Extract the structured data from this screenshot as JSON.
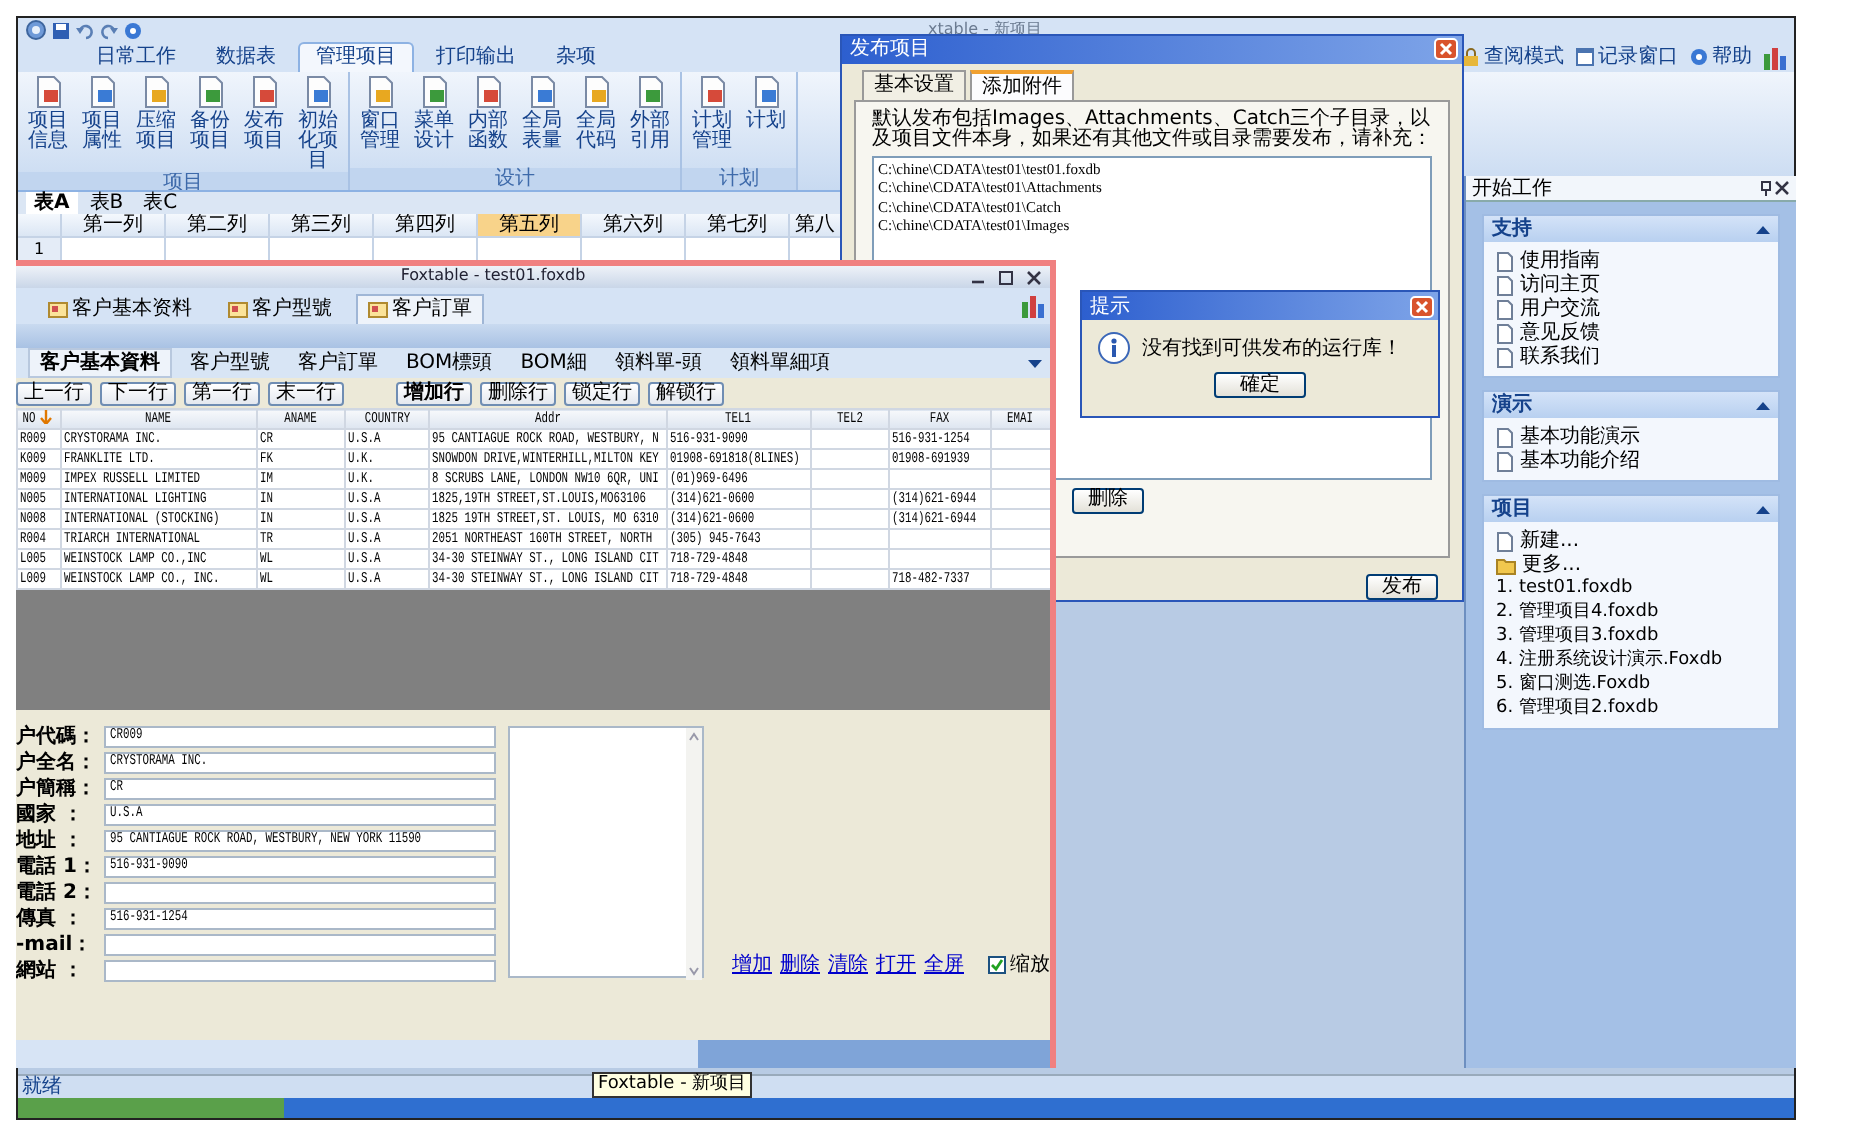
{
  "app_title": "xtable - 新项目",
  "ribbon": {
    "tabs": [
      {
        "label": "日常工作",
        "selected": false
      },
      {
        "label": "数据表",
        "selected": false
      },
      {
        "label": "管理项目",
        "selected": true
      },
      {
        "label": "打印输出",
        "selected": false
      },
      {
        "label": "杂项",
        "selected": false
      }
    ],
    "links": [
      "查阅模式",
      "记录窗口",
      "帮助"
    ],
    "groups": [
      {
        "label": "项目",
        "buttons": [
          "项目信息",
          "项目属性",
          "压缩项目",
          "备份项目",
          "发布项目",
          "初始化项目"
        ]
      },
      {
        "label": "设计",
        "buttons": [
          "窗口管理",
          "菜单设计",
          "内部函数",
          "全局表量",
          "全局代码",
          "外部引用"
        ]
      },
      {
        "label": "计划",
        "buttons": [
          "计划管理",
          "计划"
        ]
      }
    ]
  },
  "sheet_tabs": [
    {
      "label": "表A",
      "selected": true
    },
    {
      "label": "表B",
      "selected": false
    },
    {
      "label": "表C",
      "selected": false
    }
  ],
  "grid": {
    "columns": [
      {
        "label": "第一列",
        "selected": false
      },
      {
        "label": "第二列",
        "selected": false
      },
      {
        "label": "第三列",
        "selected": false
      },
      {
        "label": "第四列",
        "selected": false
      },
      {
        "label": "第五列",
        "selected": true
      },
      {
        "label": "第六列",
        "selected": false
      },
      {
        "label": "第七列",
        "selected": false
      },
      {
        "label": "第八",
        "selected": false
      }
    ],
    "row_numbers": [
      "1"
    ]
  },
  "start_panel": {
    "title": "开始工作",
    "sections": [
      {
        "title": "支持",
        "expanded": true,
        "items": [
          {
            "label": "使用指南",
            "kind": "link"
          },
          {
            "label": "访问主页",
            "kind": "link"
          },
          {
            "label": "用户交流",
            "kind": "link"
          },
          {
            "label": "意见反馈",
            "kind": "link"
          },
          {
            "label": "联系我们",
            "kind": "link"
          }
        ]
      },
      {
        "title": "演示",
        "expanded": true,
        "items": [
          {
            "label": "基本功能演示",
            "kind": "link"
          },
          {
            "label": "基本功能介绍",
            "kind": "link"
          }
        ]
      },
      {
        "title": "项目",
        "expanded": true,
        "items": [
          {
            "label": "新建...",
            "kind": "new"
          },
          {
            "label": "更多...",
            "kind": "open"
          },
          {
            "label": "1. test01.foxdb",
            "kind": "recent"
          },
          {
            "label": "2. 管理项目4.foxdb",
            "kind": "recent"
          },
          {
            "label": "3. 管理项目3.foxdb",
            "kind": "recent"
          },
          {
            "label": "4. 注册系统设计演示.Foxdb",
            "kind": "recent"
          },
          {
            "label": "5. 窗口测选.Foxdb",
            "kind": "recent"
          },
          {
            "label": "6. 管理项目2.foxdb",
            "kind": "recent"
          }
        ]
      }
    ]
  },
  "customer_window": {
    "title": "Foxtable - test01.foxdb",
    "tabs": [
      {
        "label": "客户基本资料",
        "selected": false
      },
      {
        "label": "客户型號",
        "selected": false
      },
      {
        "label": "客户訂單",
        "selected": true
      }
    ],
    "subtabs": [
      {
        "label": "客户基本資料",
        "selected": true
      },
      {
        "label": "客户型號",
        "selected": false
      },
      {
        "label": "客户訂單",
        "selected": false
      },
      {
        "label": "BOM標頭",
        "selected": false
      },
      {
        "label": "BOM細",
        "selected": false
      },
      {
        "label": "領料單-頭",
        "selected": false
      },
      {
        "label": "領料單細項",
        "selected": false
      }
    ],
    "button_groups": [
      [
        {
          "label": "上一行",
          "default": false
        },
        {
          "label": "下一行",
          "default": false
        },
        {
          "label": "第一行",
          "default": false
        },
        {
          "label": "末一行",
          "default": false
        }
      ],
      [
        {
          "label": "增加行",
          "default": true
        },
        {
          "label": "删除行",
          "default": false
        },
        {
          "label": "锁定行",
          "default": false
        },
        {
          "label": "解锁行",
          "default": false
        }
      ]
    ],
    "table": {
      "columns": [
        {
          "label": "NO",
          "sorted": true
        },
        {
          "label": "NAME",
          "sorted": false
        },
        {
          "label": "ANAME",
          "sorted": false
        },
        {
          "label": "COUNTRY",
          "sorted": false
        },
        {
          "label": "Addr",
          "sorted": false
        },
        {
          "label": "TEL1",
          "sorted": false
        },
        {
          "label": "TEL2",
          "sorted": false
        },
        {
          "label": "FAX",
          "sorted": false
        },
        {
          "label": "EMAI",
          "sorted": false
        }
      ],
      "rows": [
        [
          "R009",
          "CRYSTORAMA INC.",
          "CR",
          "U.S.A",
          "95 CANTIAGUE ROCK ROAD, WESTBURY, N",
          "516-931-9090",
          null,
          "516-931-1254",
          null
        ],
        [
          "K009",
          "FRANKLITE LTD.",
          "FK",
          "U.K.",
          "SNOWDON DRIVE,WINTERHILL,MILTON KEY",
          "01908-691818(8LINES)",
          null,
          "01908-691939",
          null
        ],
        [
          "M009",
          "IMPEX RUSSELL LIMITED",
          "IM",
          "U.K.",
          "8 SCRUBS LANE, LONDON NW10 6QR, UNI",
          "(01)969-6496",
          null,
          null,
          null
        ],
        [
          "N005",
          "INTERNATIONAL LIGHTING",
          "IN",
          "U.S.A",
          "1825,19TH STREET,ST.LOUIS,MO63106",
          "(314)621-0600",
          null,
          "(314)621-6944",
          null
        ],
        [
          "N008",
          "INTERNATIONAL (STOCKING)",
          "IN",
          "U.S.A",
          "1825 19TH STREET,ST. LOUIS, MO 6310",
          "(314)621-0600",
          null,
          "(314)621-6944",
          null
        ],
        [
          "R004",
          "TRIARCH INTERNATIONAL",
          "TR",
          "U.S.A",
          "2051 NORTHEAST 160TH STREET, NORTH",
          "(305) 945-7643",
          null,
          null,
          null
        ],
        [
          "L005",
          "WEINSTOCK LAMP CO.,INC",
          "WL",
          "U.S.A",
          "34-30 STEINWAY ST., LONG ISLAND CIT",
          "718-729-4848",
          null,
          null,
          null
        ],
        [
          "L009",
          "WEINSTOCK LAMP CO., INC.",
          "WL",
          "U.S.A",
          "34-30 STEINWAY ST., LONG ISLAND CIT",
          "718-729-4848",
          null,
          "718-482-7337",
          null
        ]
      ]
    },
    "form": {
      "fields": [
        {
          "label": "户代碼：",
          "value": "CR009"
        },
        {
          "label": "户全名：",
          "value": "CRYSTORAMA INC."
        },
        {
          "label": "户簡稱：",
          "value": "CR"
        },
        {
          "label": "國家 ：",
          "value": "U.S.A"
        },
        {
          "label": "地址 ：",
          "value": "95 CANTIAGUE ROCK ROAD, WESTBURY, NEW YORK 11590"
        },
        {
          "label": "電話 1：",
          "value": "516-931-9090"
        },
        {
          "label": "電話 2："
        },
        {
          "label": "傳真 ：",
          "value": "516-931-1254"
        },
        {
          "label": "-mail："
        },
        {
          "label": "網站 ："
        }
      ],
      "links": [
        "增加",
        "删除",
        "清除",
        "打开",
        "全屏"
      ],
      "checkbox": {
        "label": "缩放",
        "checked": true
      }
    }
  },
  "status_bar": {
    "text": "就绪",
    "tooltip": "Foxtable - 新项目"
  },
  "publish_dialog": {
    "title": "发布项目",
    "tabs": [
      {
        "label": "基本设置",
        "selected": false
      },
      {
        "label": "添加附件",
        "selected": true
      }
    ],
    "instructions": "默认发布包括Images、Attachments、Catch三个子目录，以及项目文件本身，如果还有其他文件或目录需要发布，请补充：",
    "paths": [
      "C:\\chine\\CDATA\\test01\\test01.foxdb",
      "C:\\chine\\CDATA\\test01\\Attachments",
      "C:\\chine\\CDATA\\test01\\Catch",
      "C:\\chine\\CDATA\\test01\\Images"
    ],
    "buttons": [
      "删除",
      "发布"
    ]
  },
  "message_box": {
    "title": "提示",
    "message": "没有找到可供发布的运行库！",
    "button": "確定"
  }
}
